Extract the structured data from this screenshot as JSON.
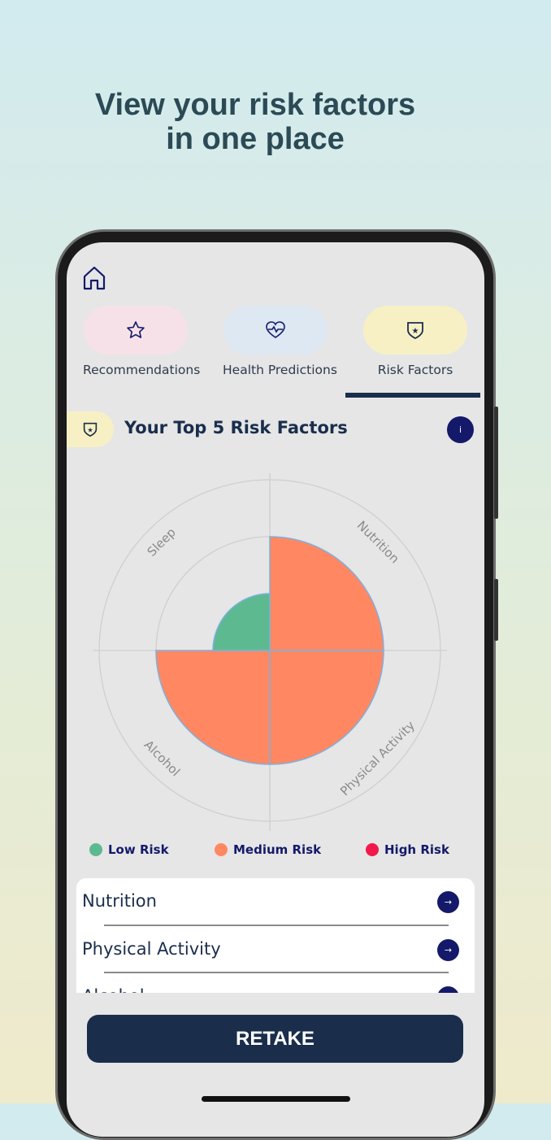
{
  "headline": {
    "line1": "View your risk factors",
    "line2": "in one place"
  },
  "tabs": [
    {
      "label": "Recommendations",
      "icon": "star-icon",
      "color": "#f7e1e8"
    },
    {
      "label": "Health Predictions",
      "icon": "heart-pulse-icon",
      "color": "#dde8f3"
    },
    {
      "label": "Risk Factors",
      "icon": "shield-star-icon",
      "color": "#f7f0c4",
      "active": true
    }
  ],
  "section": {
    "title": "Your Top 5 Risk Factors",
    "info_label": "i"
  },
  "chart_data": {
    "type": "polar-area",
    "categories": [
      "Nutrition",
      "Physical Activity",
      "Alcohol",
      "Sleep"
    ],
    "values": [
      2,
      2,
      2,
      1
    ],
    "risk_levels": [
      "Medium",
      "Medium",
      "Medium",
      "Low"
    ],
    "rlim": [
      0,
      3
    ],
    "grid": true
  },
  "legend": [
    {
      "label": "Low Risk",
      "color": "#5dba90"
    },
    {
      "label": "Medium Risk",
      "color": "#ff8862"
    },
    {
      "label": "High Risk",
      "color": "#f2194a"
    }
  ],
  "list": [
    {
      "label": "Nutrition",
      "arrow": "→"
    },
    {
      "label": "Physical Activity",
      "arrow": "→"
    },
    {
      "label": "Alcohol",
      "arrow": "→"
    }
  ],
  "retake_label": "RETAKE"
}
